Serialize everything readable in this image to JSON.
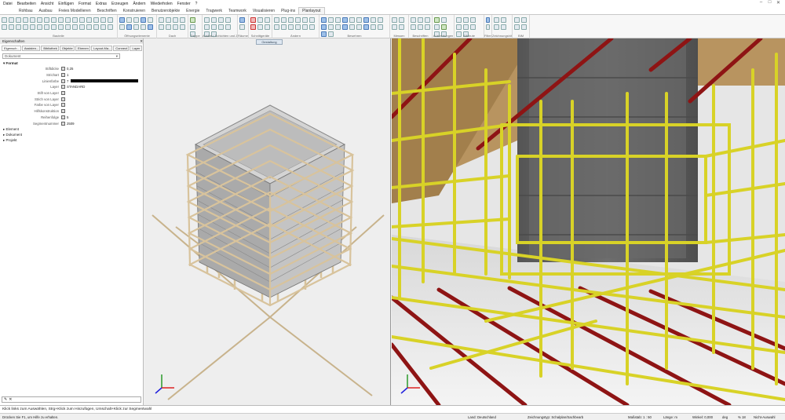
{
  "menu": [
    "Datei",
    "Bearbeiten",
    "Ansicht",
    "Einfügen",
    "Format",
    "Extras",
    "Erzeugen",
    "Ändern",
    "Wiederholen",
    "Fenster",
    "?"
  ],
  "window_controls": [
    "–",
    "□",
    "✕"
  ],
  "tabs": [
    "Rohbau",
    "Ausbau",
    "Freies Modellieren",
    "Beschriften",
    "Konstruieren",
    "Benutzerobjekte",
    "Energie",
    "Tragwerk",
    "Teamwork",
    "Visualisieren",
    "Plug-ins",
    "Planlayout"
  ],
  "active_tab": "Planlayout",
  "ribbon_groups": [
    "Bauteile",
    "Öffnungselemente",
    "Dach",
    "Treppe",
    "Ausbau, Schichten und Zu...",
    "Räume",
    "Schnittgeräte",
    "Ändern",
    "Bewehren",
    "Messen",
    "Beschriften",
    "Auswertungen",
    "Attribute",
    "Filter",
    "Zeichnungshilfe",
    "BIM"
  ],
  "view_tab": "Gestaltung",
  "panel": {
    "title": "Eigenschaften",
    "tabs": [
      "Eigensch...",
      "Assisten...",
      "Bibliothek",
      "Objekte",
      "Ebenen",
      "Layout-Ma...",
      "Connect",
      "Layer"
    ],
    "selector": "Dokument",
    "format_label": "Format",
    "rows": [
      {
        "label": "Stiftdicke",
        "value": "0,25"
      },
      {
        "label": "Strichart",
        "value": "1"
      },
      {
        "label": "Linienfarbe",
        "value": "7"
      },
      {
        "label": "Layer",
        "value": "STANDARD"
      },
      {
        "label": "Stift von Layer",
        "value": ""
      },
      {
        "label": "Strich von Layer",
        "value": ""
      },
      {
        "label": "Farbe von Layer",
        "value": ""
      },
      {
        "label": "Hilfskonstruktion",
        "value": ""
      },
      {
        "label": "Reihenfolge",
        "value": "5"
      },
      {
        "label": "Segmentnummer",
        "value": "2509"
      }
    ],
    "sections": [
      "Element",
      "Dokument",
      "Projekt"
    ],
    "bottom_icons": [
      "✎",
      "✕"
    ]
  },
  "hint": "Klick links zum Auswählen, Strg+Klick zum Hinzufügen, Umschalt+Klick zur Segmentwahl",
  "status": {
    "help": "Drücken Sie F1, um Hilfe zu erhalten.",
    "land": "Land: Deutschland",
    "zeichnungstyp": "Zeichnungstyp: Schalplan/Sachbearb",
    "massstab": "Maßstab: 1 : 50",
    "laenge": "Länge: m",
    "winkel": "Winkel: 0,000",
    "grad": "deg",
    "pct": "% 18",
    "nicht": "Nicht-Auswahl"
  },
  "colors": {
    "accent": "#1a5aa8",
    "rebar_yellow": "#d8d227",
    "rebar_red": "#8e1414",
    "concrete": "#6b6b6b",
    "wood": "#b88a4e"
  }
}
